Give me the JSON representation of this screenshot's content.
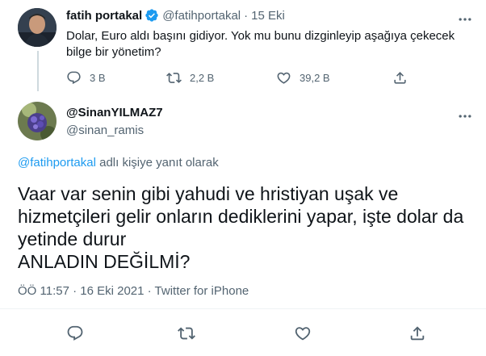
{
  "parent_tweet": {
    "display_name": "fatih portakal",
    "handle": "@fatihportakal",
    "separator": "·",
    "date": "15 Eki",
    "text_line1": "Dolar, Euro aldı başını gidiyor. Yok mu bunu dizginleyip aşağıya çekecek",
    "text_line2": "bilge bir yönetim?",
    "replies": "3 B",
    "retweets": "2,2 B",
    "likes": "39,2 B",
    "verified": true
  },
  "main_tweet": {
    "display_name": "@SinanYILMAZ7",
    "handle": "@sinan_ramis",
    "reply_to_handle": "@fatihportakal",
    "reply_to_suffix": " adlı kişiye yanıt olarak",
    "text_line1": "Vaar var senin gibi yahudi ve hristiyan uşak ve",
    "text_line2": "hizmetçileri gelir onların dediklerini yapar, işte dolar da",
    "text_line3": "yetinde durur",
    "text_line4": "ANLADIN DEĞİLMİ?",
    "timestamp": "ÖÖ 11:57 · 16 Eki 2021 · Twitter for iPhone"
  },
  "colors": {
    "accent": "#1d9bf0",
    "muted_text": "#536471",
    "primary_text": "#0f1419",
    "divider": "#eff3f4"
  },
  "icons": [
    "verified-badge-icon",
    "more-icon",
    "reply-icon",
    "retweet-icon",
    "like-icon",
    "share-icon"
  ]
}
